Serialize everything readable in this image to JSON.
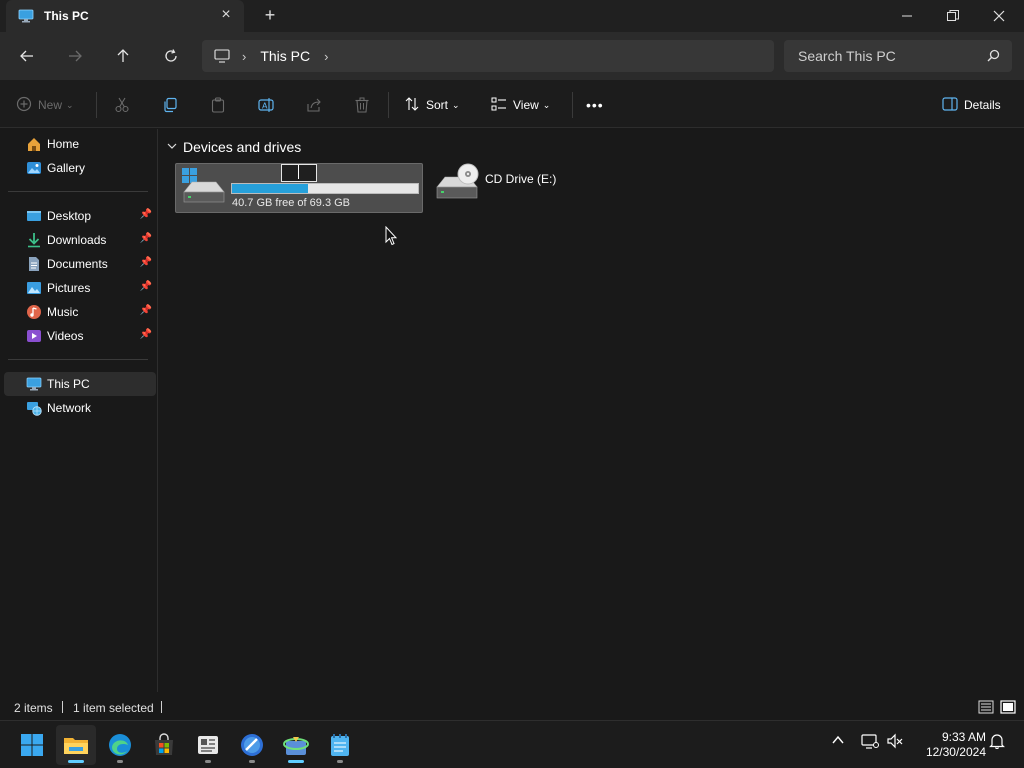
{
  "window": {
    "tab_title": "This PC",
    "tab_icon": "monitor-icon",
    "new_tab": "+",
    "controls": [
      "minimize-icon",
      "restore-icon",
      "close-icon"
    ]
  },
  "address": {
    "crumb": "This PC",
    "search_placeholder": "Search This PC"
  },
  "commands": {
    "new": "New",
    "sort": "Sort",
    "view": "View",
    "more": "•••",
    "details": "Details"
  },
  "sidebar": {
    "items": [
      {
        "label": "Home",
        "icon": "home-icon"
      },
      {
        "label": "Gallery",
        "icon": "gallery-icon"
      },
      {
        "label": "Desktop",
        "icon": "desktop-icon",
        "pinned": true
      },
      {
        "label": "Downloads",
        "icon": "downloads-icon",
        "pinned": true
      },
      {
        "label": "Documents",
        "icon": "documents-icon",
        "pinned": true
      },
      {
        "label": "Pictures",
        "icon": "pictures-icon",
        "pinned": true
      },
      {
        "label": "Music",
        "icon": "music-icon",
        "pinned": true
      },
      {
        "label": "Videos",
        "icon": "videos-icon",
        "pinned": true
      },
      {
        "label": "This PC",
        "icon": "this-pc-icon",
        "selected": true
      },
      {
        "label": "Network",
        "icon": "network-icon"
      }
    ]
  },
  "content": {
    "group_title": "Devices and drives",
    "drives": [
      {
        "name": "",
        "editing": true,
        "free_text": "40.7 GB free of 69.3 GB",
        "used_fraction": 0.41,
        "selected": true
      },
      {
        "name": "CD Drive (E:)"
      }
    ]
  },
  "status": {
    "item_count": "2 items",
    "selection": "1 item selected"
  },
  "taskbar": {
    "apps": [
      "start-icon",
      "file-explorer-icon",
      "edge-icon",
      "store-icon",
      "news-icon",
      "browser-icon",
      "installer-icon",
      "notepad-icon"
    ],
    "time": "9:33 AM",
    "date": "12/30/2024"
  },
  "colors": {
    "accent": "#60cdff",
    "progress": "#26a0da",
    "background": "#191919"
  }
}
